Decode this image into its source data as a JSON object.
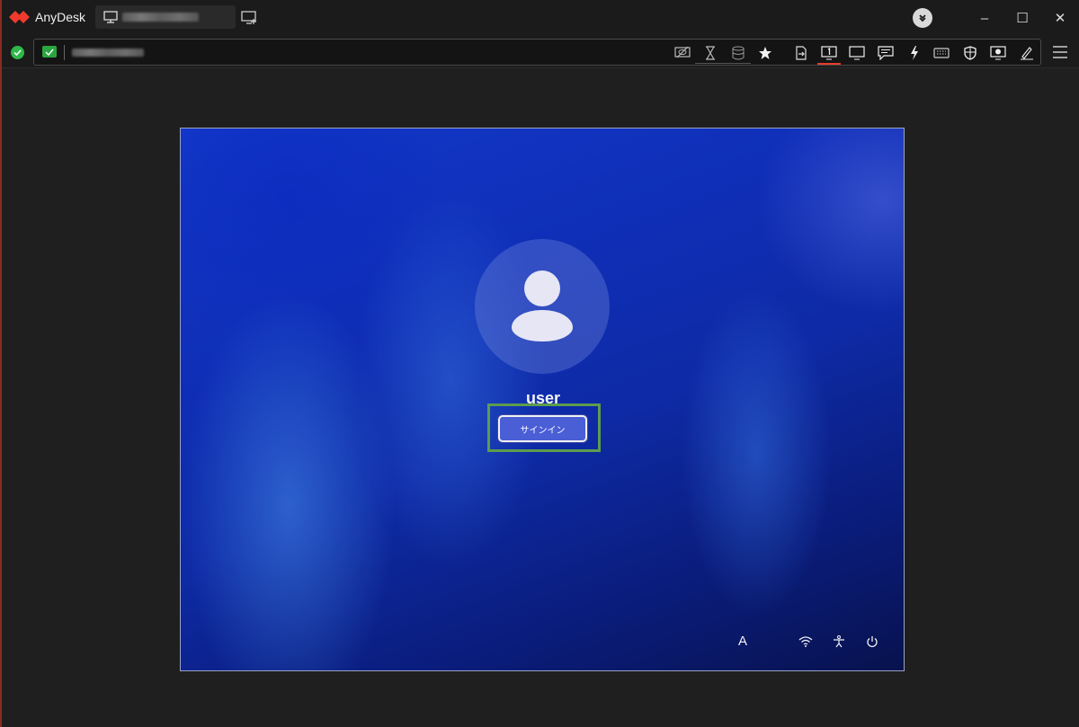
{
  "app": {
    "name": "AnyDesk"
  },
  "titlebar": {
    "session_tab_icon": "monitor-icon",
    "new_session_icon": "monitor-plus-icon",
    "download_icon": "download-icon",
    "minimize_label": "–",
    "maximize_label": "☐",
    "close_label": "✕"
  },
  "toolbar": {
    "status_icon": "connected-check-icon",
    "icons": [
      "privacy-screen-icon",
      "hourglass-icon",
      "database-icon",
      "star-icon",
      "file-transfer-icon",
      "monitor-1-icon",
      "display-icon",
      "chat-icon",
      "lightning-icon",
      "keyboard-icon",
      "shield-icon",
      "screenshot-icon",
      "whiteboard-pen-icon"
    ],
    "menu_icon": "hamburger-menu-icon"
  },
  "remote": {
    "username": "user",
    "signin_label": "サインイン",
    "language_indicator": "A",
    "tray_icons": [
      "wifi-icon",
      "accessibility-icon",
      "power-icon"
    ]
  },
  "colors": {
    "accent_red": "#e23d2b",
    "status_green": "#2fb84a",
    "highlight_green": "#5d9c4f",
    "signin_button": "#4a5ed6"
  }
}
